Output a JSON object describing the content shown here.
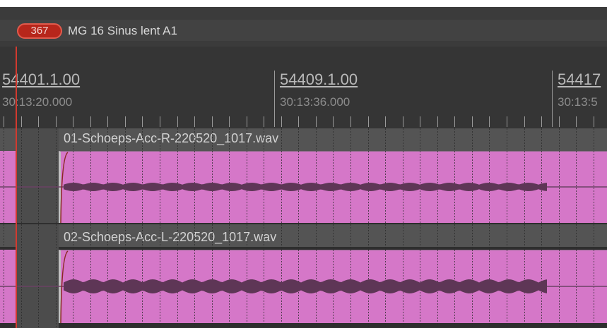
{
  "marker": {
    "number": "367",
    "name": "MG 16 Sinus lent A1"
  },
  "ruler": {
    "bars": [
      {
        "label": "54401.1.00",
        "time": "30:13:20.000"
      },
      {
        "label": "54409.1.00",
        "time": "30:13:36.000"
      },
      {
        "label": "54417",
        "time": "30:13:5"
      }
    ]
  },
  "tracks": [
    {
      "region_name": "01-Schoeps-Acc-R-220520_1017.wav"
    },
    {
      "region_name": "02-Schoeps-Acc-L-220520_1017.wav"
    }
  ],
  "colors": {
    "region": "#d577c8",
    "waveform": "#5e3656",
    "marker": "#b7261b",
    "playhead": "#d23a2f"
  }
}
